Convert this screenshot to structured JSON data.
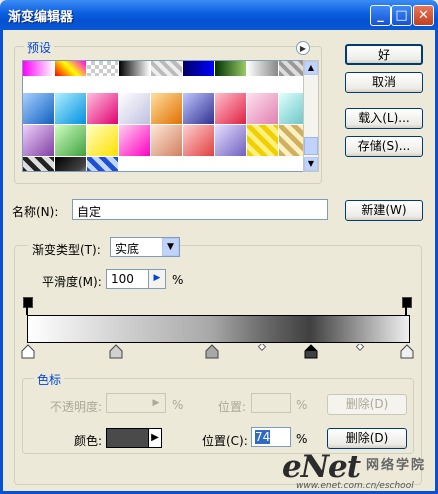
{
  "window": {
    "title": "渐变编辑器"
  },
  "buttons": {
    "ok": "好",
    "cancel": "取消",
    "load": "载入(L)...",
    "save": "存储(S)...",
    "new": "新建(W)",
    "delete_opacity": "删除(D)",
    "delete_color": "删除(D)"
  },
  "presets": {
    "label": "预设"
  },
  "name": {
    "label": "名称(N):",
    "value": "自定"
  },
  "gradient": {
    "group_label": "",
    "type_label": "渐变类型(T):",
    "type_value": "实底",
    "smooth_label": "平滑度(M):",
    "smooth_value": "100",
    "smooth_unit": "%"
  },
  "stops": {
    "group_label": "色标",
    "opacity_label": "不透明度:",
    "opacity_unit": "%",
    "location_label1": "位置:",
    "location_unit1": "%",
    "color_label": "颜色:",
    "location_label2": "位置(C):",
    "location_value": "74",
    "location_unit2": "%"
  },
  "watermark": {
    "brand": "eNet",
    "cn": "网络学院",
    "url": "www.enet.com.cn/eschool"
  }
}
